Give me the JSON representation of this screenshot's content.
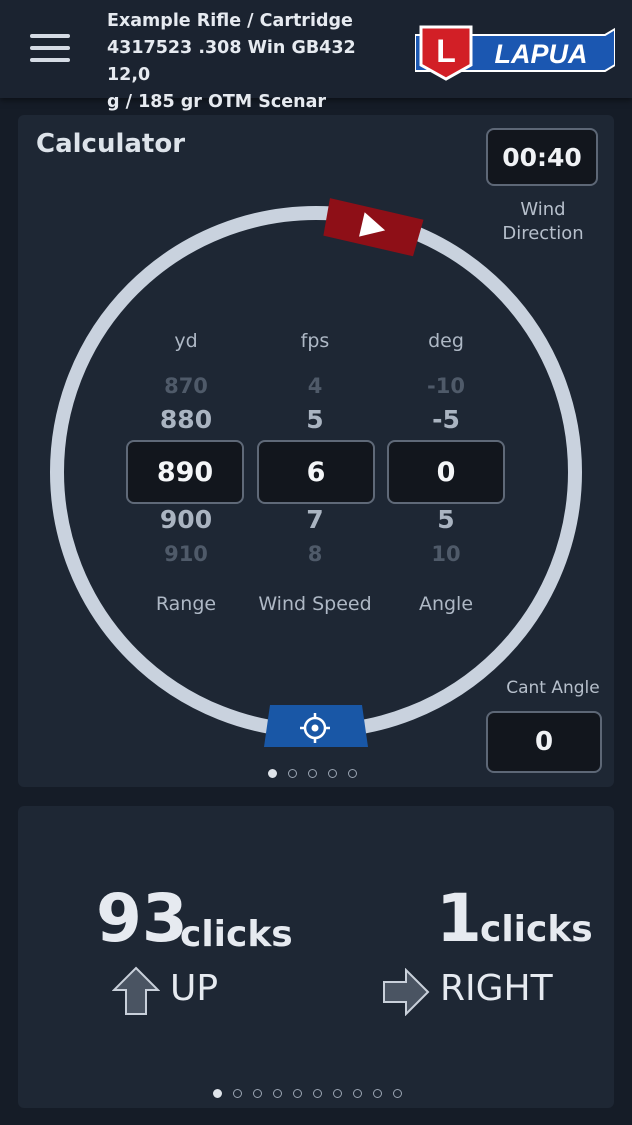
{
  "header": {
    "profile_title": "Example Rifle / Cartridge\n4317523 .308 Win GB432 12,0\ng / 185 gr  OTM Scenar",
    "logo_text": "LAPUA",
    "logo_letter": "L"
  },
  "calculator": {
    "title": "Calculator",
    "wind_direction_value": "00:40",
    "wind_direction_label": "Wind\nDirection",
    "range": {
      "unit": "yd",
      "label": "Range",
      "values": [
        "870",
        "880",
        "890",
        "900",
        "910"
      ],
      "selected": "890"
    },
    "wind_speed": {
      "unit": "fps",
      "label": "Wind Speed",
      "values": [
        "4",
        "5",
        "6",
        "7",
        "8"
      ],
      "selected": "6"
    },
    "angle": {
      "unit": "deg",
      "label": "Angle",
      "values": [
        "-10",
        "-5",
        "0",
        "5",
        "10"
      ],
      "selected": "0"
    },
    "cant_angle_label": "Cant Angle",
    "cant_angle_value": "0",
    "page_dots": {
      "count": 5,
      "active": 0
    }
  },
  "result": {
    "elevation_clicks": "93",
    "elevation_word": "clicks",
    "elevation_direction": "UP",
    "windage_clicks": "1",
    "windage_word": "clicks",
    "windage_direction": "RIGHT",
    "page_dots": {
      "count": 10,
      "active": 0
    }
  },
  "colors": {
    "wind_marker": "#8e0f17",
    "target_marker": "#1957a6",
    "ring": "#c9d2de",
    "logo_red": "#d21f26",
    "logo_blue": "#1b57b1"
  },
  "icons": {
    "menu": "hamburger-icon",
    "wind_marker": "play-icon",
    "target_marker": "crosshair-icon",
    "up_arrow": "arrow-up-icon",
    "right_arrow": "arrow-right-icon"
  }
}
